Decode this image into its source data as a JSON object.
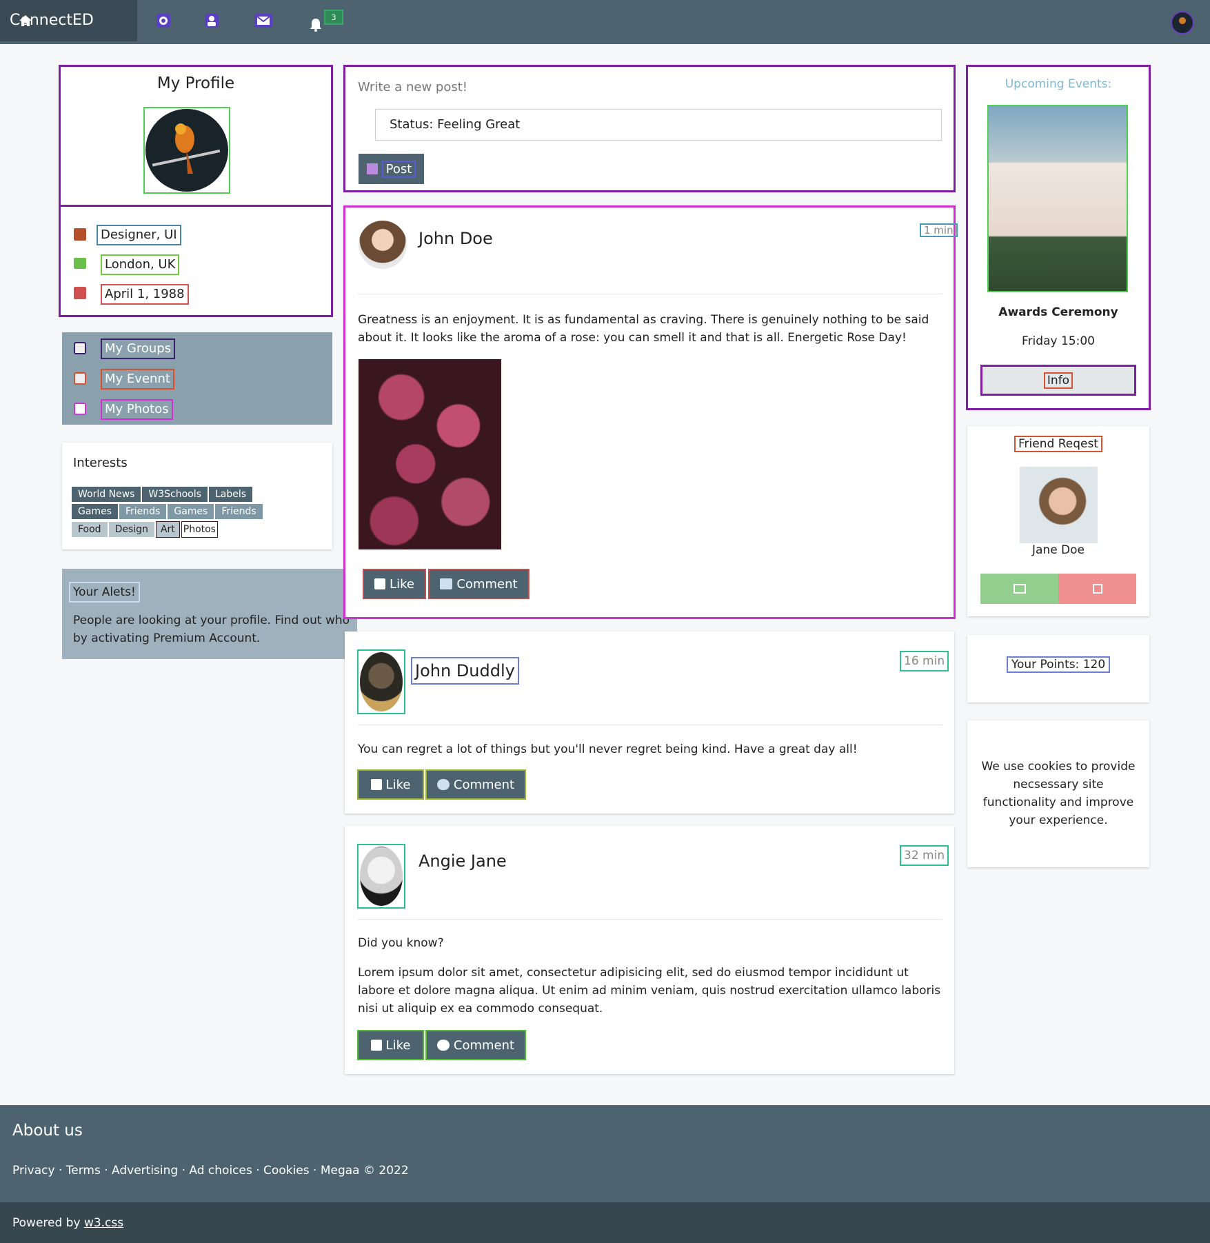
{
  "nav": {
    "brand": "ConnectED",
    "icons": [
      "home-icon",
      "globe-icon",
      "user-icon",
      "envelope-icon",
      "bell-icon"
    ],
    "notification_count": "3"
  },
  "profile": {
    "title": "My Profile",
    "job": "Designer, UI",
    "location": "London, UK",
    "birthday": "April 1, 1988"
  },
  "menu": {
    "groups": "My Groups",
    "events": "My Evennt",
    "photos": "My Photos"
  },
  "interests": {
    "title": "Interests",
    "tags": [
      "World News",
      "W3Schools",
      "Labels",
      "Games",
      "Friends",
      "Games",
      "Friends",
      "Food",
      "Design",
      "Art",
      "Photos"
    ]
  },
  "alert": {
    "title": "Your Alets!",
    "body": "People are looking at your profile. Find out who by activating Premium Account."
  },
  "composer": {
    "placeholder": "Write a new post!",
    "status": "Status: Feeling Great",
    "post_label": "Post"
  },
  "posts": [
    {
      "author": "John Doe",
      "time": "1 min",
      "body": "Greatness is an enjoyment. It is as fundamental as craving. There is genuinely nothing to be said about it. It looks like the aroma of a rose: you can smell it and that is all. Energetic Rose Day!",
      "like": "Like",
      "comment": "Comment"
    },
    {
      "author": "John Duddly",
      "time": "16 min",
      "body": "You can regret a lot of things but you'll never regret being kind. Have a great day all!",
      "like": "Like",
      "comment": "Comment"
    },
    {
      "author": "Angie Jane",
      "time": "32 min",
      "intro": "Did you know?",
      "body": "Lorem ipsum dolor sit amet, consectetur adipisicing elit, sed do eiusmod tempor incididunt ut labore et dolore magna aliqua. Ut enim ad minim veniam, quis nostrud exercitation ullamco laboris nisi ut aliquip ex ea commodo consequat.",
      "like": "Like",
      "comment": "Comment"
    }
  ],
  "events": {
    "title": "Upcoming Events:",
    "name": "Awards Ceremony",
    "time": "Friday 15:00",
    "info": "Info"
  },
  "friend": {
    "title": "Friend Reqest",
    "name": "Jane Doe"
  },
  "points": "Your Points: 120",
  "cookies": "We use cookies to provide necsessary site functionality and improve your experience.",
  "footer": {
    "about": "About us",
    "links": "Privacy · Terms · Advertising · Ad choices · Cookies · Megaa © 2022",
    "powered_prefix": "Powered by ",
    "powered_link": "w3.css"
  },
  "colors": {
    "nav": "#4d636f",
    "footer_dark": "#37474f",
    "accent_purple": "#7d1fa0",
    "accent_magenta": "#d12fd1"
  }
}
